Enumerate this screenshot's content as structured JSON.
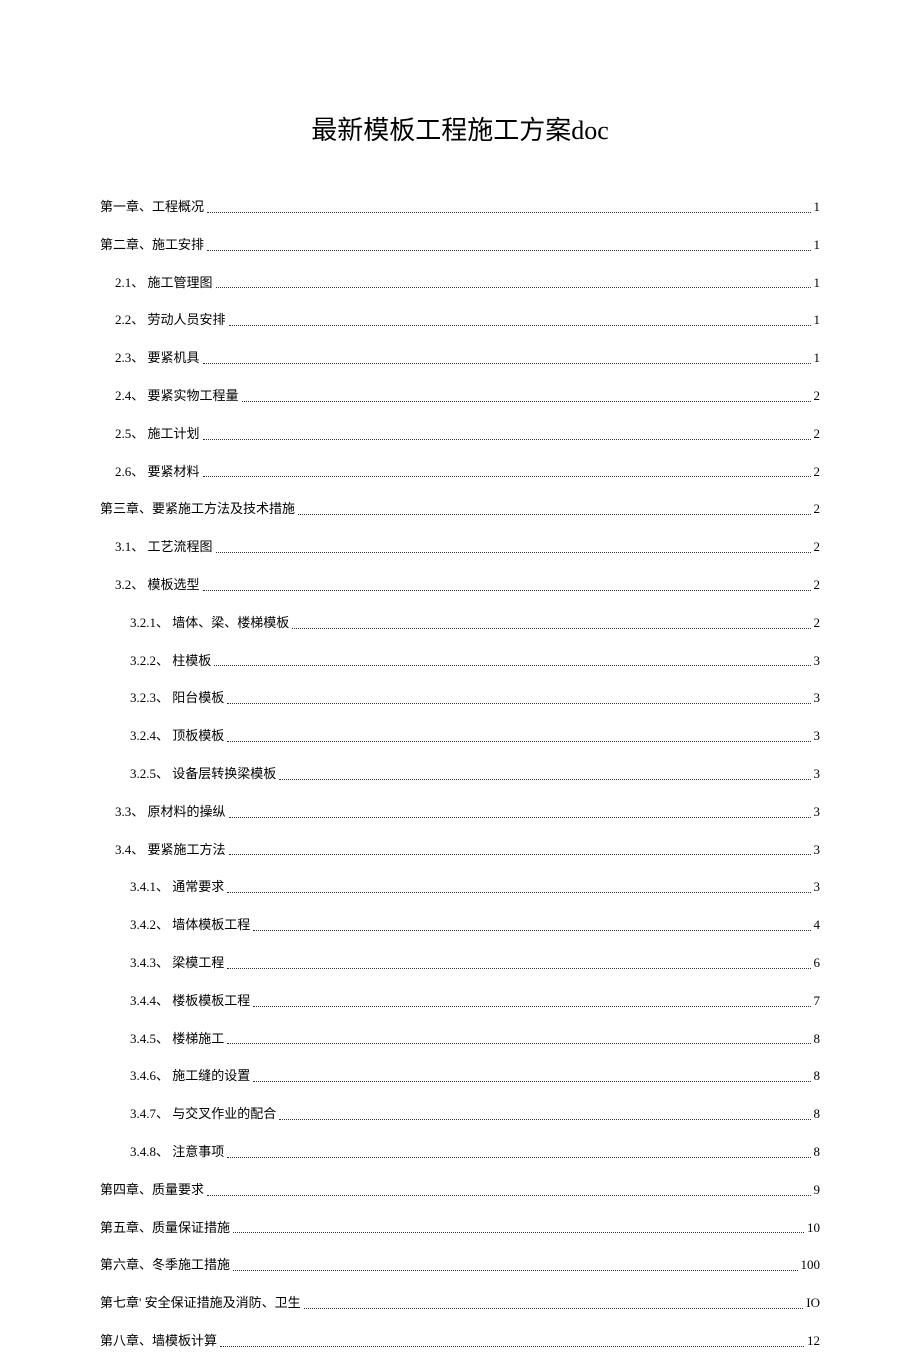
{
  "title": "最新模板工程施工方案doc",
  "toc": [
    {
      "level": 0,
      "text": "第一章、工程概况",
      "page": "1"
    },
    {
      "level": 0,
      "text": "第二章、施工安排",
      "page": "1"
    },
    {
      "level": 1,
      "text": "2.1、 施工管理图",
      "page": "1"
    },
    {
      "level": 1,
      "text": "2.2、 劳动人员安排",
      "page": "1"
    },
    {
      "level": 1,
      "text": "2.3、 要紧机具",
      "page": "1"
    },
    {
      "level": 1,
      "text": "2.4、 要紧实物工程量",
      "page": "2"
    },
    {
      "level": 1,
      "text": "2.5、 施工计划",
      "page": "2"
    },
    {
      "level": 1,
      "text": "2.6、 要紧材料",
      "page": "2"
    },
    {
      "level": 0,
      "text": "第三章、要紧施工方法及技术措施",
      "page": "2"
    },
    {
      "level": 1,
      "text": "3.1、 工艺流程图",
      "page": "2"
    },
    {
      "level": 1,
      "text": "3.2、 模板选型",
      "page": "2"
    },
    {
      "level": 2,
      "text": "3.2.1、 墙体、梁、楼梯模板",
      "page": "2"
    },
    {
      "level": 2,
      "text": "3.2.2、 柱模板",
      "page": "3"
    },
    {
      "level": 2,
      "text": "3.2.3、 阳台模板",
      "page": "3"
    },
    {
      "level": 2,
      "text": "3.2.4、 顶板模板",
      "page": "3"
    },
    {
      "level": 2,
      "text": "3.2.5、 设备层转换梁模板",
      "page": "3"
    },
    {
      "level": 1,
      "text": "3.3、 原材料的操纵",
      "page": "3"
    },
    {
      "level": 1,
      "text": "3.4、 要紧施工方法",
      "page": "3"
    },
    {
      "level": 2,
      "text": "3.4.1、 通常要求",
      "page": "3"
    },
    {
      "level": 2,
      "text": "3.4.2、 墙体模板工程",
      "page": "4"
    },
    {
      "level": 2,
      "text": "3.4.3、 梁模工程",
      "page": "6"
    },
    {
      "level": 2,
      "text": "3.4.4、 楼板模板工程",
      "page": "7"
    },
    {
      "level": 2,
      "text": "3.4.5、 楼梯施工",
      "page": "8"
    },
    {
      "level": 2,
      "text": "3.4.6、 施工缝的设置",
      "page": "8"
    },
    {
      "level": 2,
      "text": "3.4.7、 与交叉作业的配合",
      "page": "8"
    },
    {
      "level": 2,
      "text": "3.4.8、 注意事项",
      "page": "8"
    },
    {
      "level": 0,
      "text": "第四章、质量要求",
      "page": "9"
    },
    {
      "level": 0,
      "text": "第五章、质量保证措施",
      "page": "10"
    },
    {
      "level": 0,
      "text": "第六章、冬季施工措施",
      "page": "100"
    },
    {
      "level": 0,
      "text": "第七章' 安全保证措施及消防、卫生",
      "page": "IO"
    },
    {
      "level": 0,
      "text": "第八章、墙模板计算",
      "page": "12"
    }
  ]
}
